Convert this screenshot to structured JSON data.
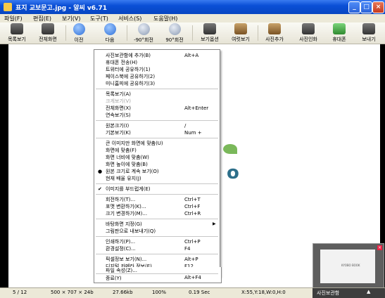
{
  "window": {
    "title": "표지 교보문고.jpg - 알씨 v6.71"
  },
  "menubar": [
    "파일(F)",
    "편집(E)",
    "보기(V)",
    "도구(T)",
    "서비스(S)",
    "도움말(H)"
  ],
  "toolbar": [
    "목록보기",
    "전체화면",
    "이전",
    "다음",
    "-90°회전",
    "90°회전",
    "보기옵션",
    "여럿보기",
    "사진추가",
    "사진인화",
    "휴대폰",
    "보내기"
  ],
  "image_text": "o",
  "context_menu": {
    "items": [
      {
        "label": "사진보관함에 추가(B)",
        "key": "Alt+A"
      },
      {
        "label": "휴대폰 전송(H)",
        "key": ""
      },
      {
        "label": "트위터에 공유하기(1)",
        "key": ""
      },
      {
        "label": "페이스북에 공유하기(2)",
        "key": ""
      },
      {
        "label": "미니홈피에 공유하기(3)",
        "key": ""
      },
      {
        "label": "목록보기(A)",
        "key": ""
      },
      {
        "label": "크게보기(V)",
        "key": ""
      },
      {
        "label": "전체화면(X)",
        "key": "Alt+Enter"
      },
      {
        "label": "연속보기(S)",
        "key": ""
      },
      {
        "label": "원본크기(I)",
        "key": "/"
      },
      {
        "label": "기본보기(K)",
        "key": "Num +"
      },
      {
        "label": "큰 이미지만 화면에 맞춤(U)",
        "key": ""
      },
      {
        "label": "화면에 맞춤(F)",
        "key": ""
      },
      {
        "label": "화면 너비에 맞춤(W)",
        "key": ""
      },
      {
        "label": "화면 높이에 맞춤(B)",
        "key": ""
      },
      {
        "label": "원본 크기로 계속 보기(O)",
        "key": ""
      },
      {
        "label": "현재 배율 유지(J)",
        "key": ""
      },
      {
        "label": "이미지를 부드럽게(E)",
        "key": ""
      },
      {
        "label": "회전하기(T)...",
        "key": "Ctrl+T"
      },
      {
        "label": "포맷 변환하기(K)...",
        "key": "Ctrl+F"
      },
      {
        "label": "크기 변경하기(M)...",
        "key": "Ctrl+R"
      },
      {
        "label": "바탕화면 지정(G)",
        "key": ""
      },
      {
        "label": "그림판으로 내보내기(Q)",
        "key": ""
      },
      {
        "label": "인쇄하기(P)...",
        "key": "Ctrl+P"
      },
      {
        "label": "환경설정(C)...",
        "key": "F4"
      },
      {
        "label": "픽셀정보 보기(N)...",
        "key": "Alt+P"
      },
      {
        "label": "디지털 카메라 정보(E)...",
        "key": "F12"
      },
      {
        "label": "파일 속성(Z)...",
        "key": ""
      },
      {
        "label": "종료(Y)",
        "key": "Alt+F4"
      }
    ]
  },
  "thumbnail": {
    "caption": "KYOBO BOOK"
  },
  "statusbar": {
    "index": "5 / 12",
    "dimensions": "500 × 707 × 24b",
    "filesize": "27.66kb",
    "zoom": "100%",
    "time": "0.19 Sec",
    "coords": "X:55,Y:18,W:0,H:0",
    "navigator_label": "사진보관함",
    "navigator_arrow": "▲"
  }
}
